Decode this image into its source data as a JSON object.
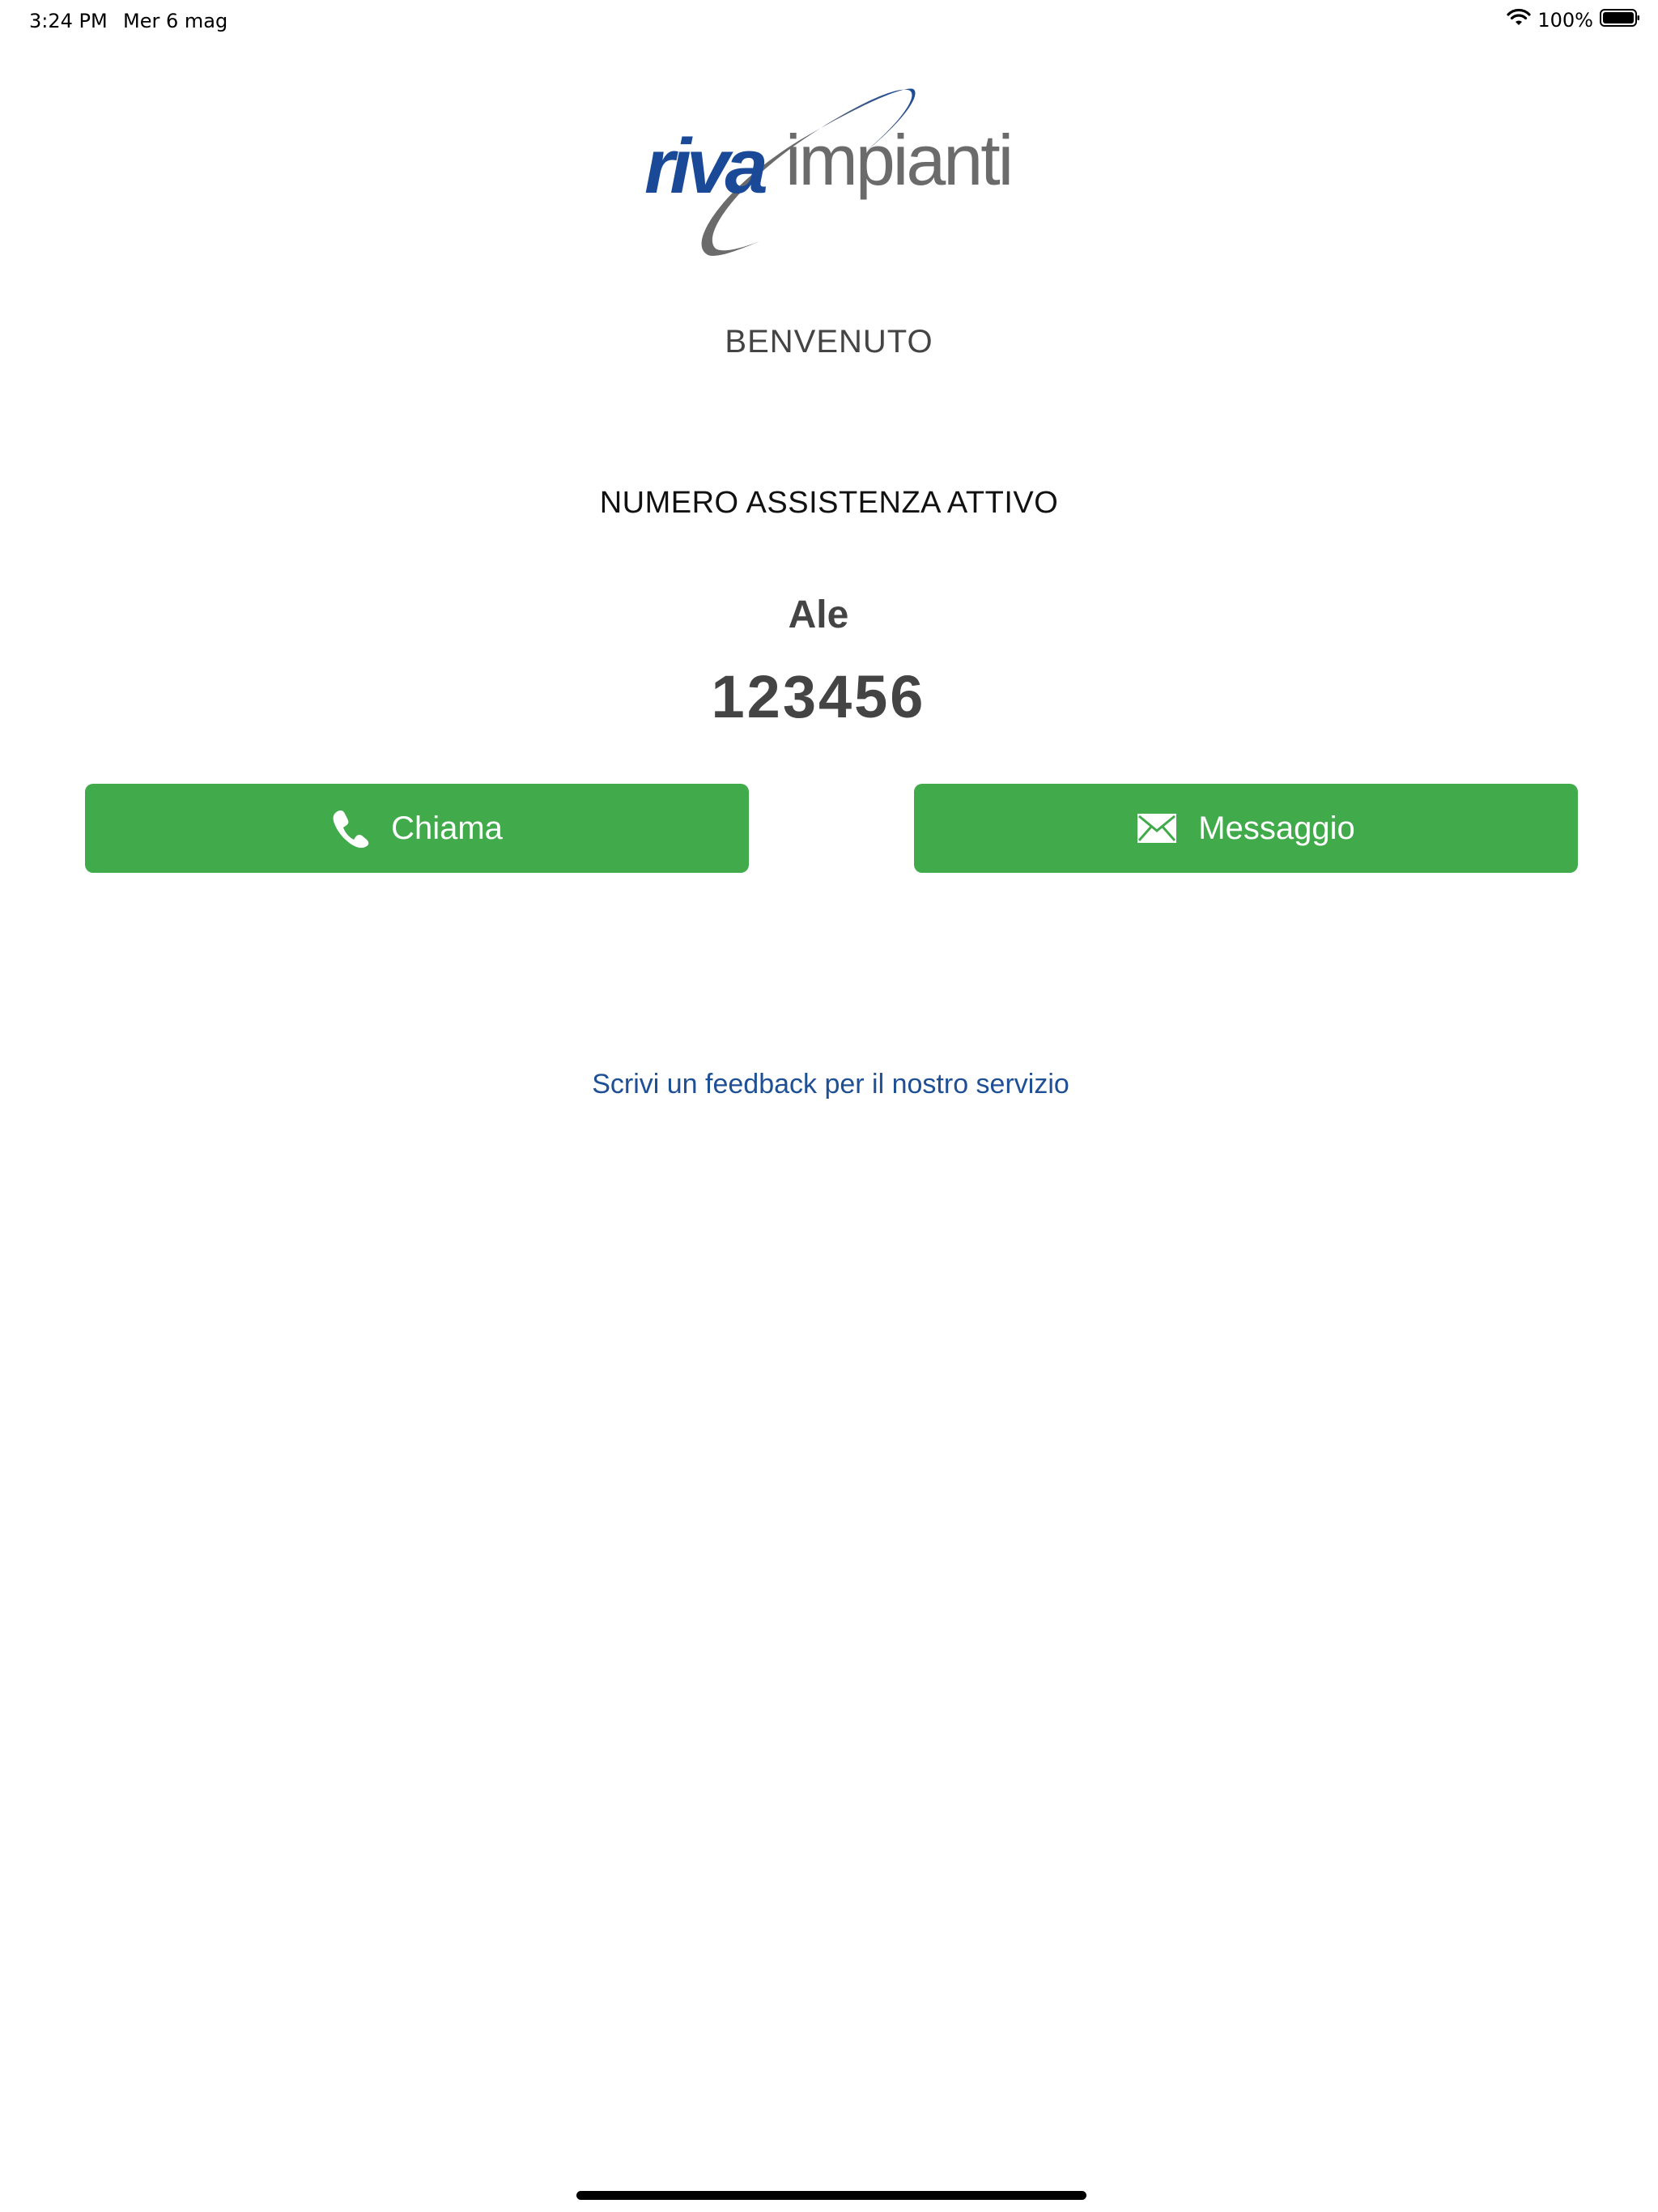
{
  "status_bar": {
    "time": "3:24 PM",
    "date": "Mer 6 mag",
    "battery": "100%",
    "wifi_icon": "wifi-icon",
    "battery_icon": "battery-full-icon"
  },
  "logo": {
    "brand_primary": "riva",
    "brand_secondary": "impianti",
    "primary_color": "#1a4a97",
    "secondary_color": "#6b6b6b"
  },
  "welcome": "BENVENUTO",
  "support": {
    "label": "NUMERO ASSISTENZA ATTIVO",
    "name": "Ale",
    "number": "123456"
  },
  "actions": {
    "call_label": "Chiama",
    "call_icon": "phone-icon",
    "message_label": "Messaggio",
    "message_icon": "envelope-icon",
    "button_color": "#41ab4b"
  },
  "feedback": {
    "link_text": "Scrivi un feedback per il nostro servizio",
    "link_color": "#1f4f95"
  }
}
